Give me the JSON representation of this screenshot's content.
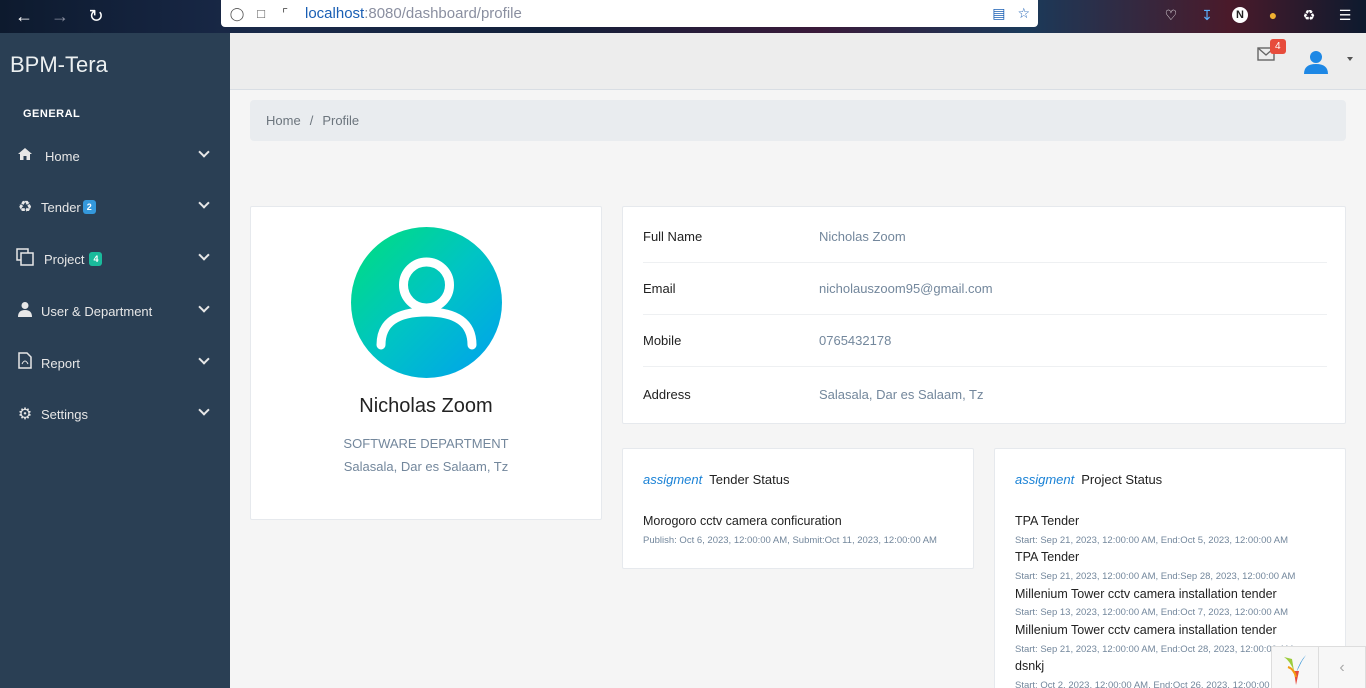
{
  "browser": {
    "url_host": "localhost",
    "url_path": ":8080/dashboard/profile"
  },
  "sidebar": {
    "brand": "BPM-Tera",
    "section": "GENERAL",
    "items": [
      {
        "label": "Home",
        "icon": "home-icon",
        "badge": ""
      },
      {
        "label": "Tender",
        "icon": "recycle-icon",
        "badge": "2"
      },
      {
        "label": "Project",
        "icon": "copy-icon",
        "badge": "4"
      },
      {
        "label": "User & Department",
        "icon": "user-icon",
        "badge": ""
      },
      {
        "label": "Report",
        "icon": "pdf-icon",
        "badge": ""
      },
      {
        "label": "Settings",
        "icon": "gear-icon",
        "badge": ""
      }
    ]
  },
  "topnav": {
    "mail_count": "4"
  },
  "breadcrumb": {
    "home": "Home",
    "sep": "/",
    "current": "Profile"
  },
  "profile": {
    "name": "Nicholas Zoom",
    "department": "SOFTWARE DEPARTMENT",
    "address": "Salasala, Dar es Salaam, Tz"
  },
  "info": [
    {
      "key": "Full Name",
      "value": "Nicholas Zoom"
    },
    {
      "key": "Email",
      "value": "nicholauszoom95@gmail.com"
    },
    {
      "key": "Mobile",
      "value": "0765432178"
    },
    {
      "key": "Address",
      "value": "Salasala, Dar es Salaam, Tz"
    }
  ],
  "tender_status": {
    "tag": "assigment",
    "title": "Tender Status",
    "items": [
      {
        "title": "Morogoro cctv camera conficuration",
        "sub": "Publish: Oct 6, 2023, 12:00:00 AM, Submit:Oct 11, 2023, 12:00:00 AM"
      }
    ]
  },
  "project_status": {
    "tag": "assigment",
    "title": "Project Status",
    "items": [
      {
        "title": "TPA Tender",
        "sub": "Start: Sep 21, 2023, 12:00:00 AM, End:Oct 5, 2023, 12:00:00 AM"
      },
      {
        "title": "TPA Tender",
        "sub": "Start: Sep 21, 2023, 12:00:00 AM, End:Sep 28, 2023, 12:00:00 AM"
      },
      {
        "title": "Millenium Tower cctv camera installation tender",
        "sub": "Start: Sep 13, 2023, 12:00:00 AM, End:Oct 7, 2023, 12:00:00 AM"
      },
      {
        "title": "Millenium Tower cctv camera installation tender",
        "sub": "Start: Sep 21, 2023, 12:00:00 AM, End:Oct 28, 2023, 12:00:00 AM"
      },
      {
        "title": "dsnkj",
        "sub": "Start: Oct 2, 2023, 12:00:00 AM, End:Oct 26, 2023, 12:00:00 AM"
      }
    ]
  }
}
